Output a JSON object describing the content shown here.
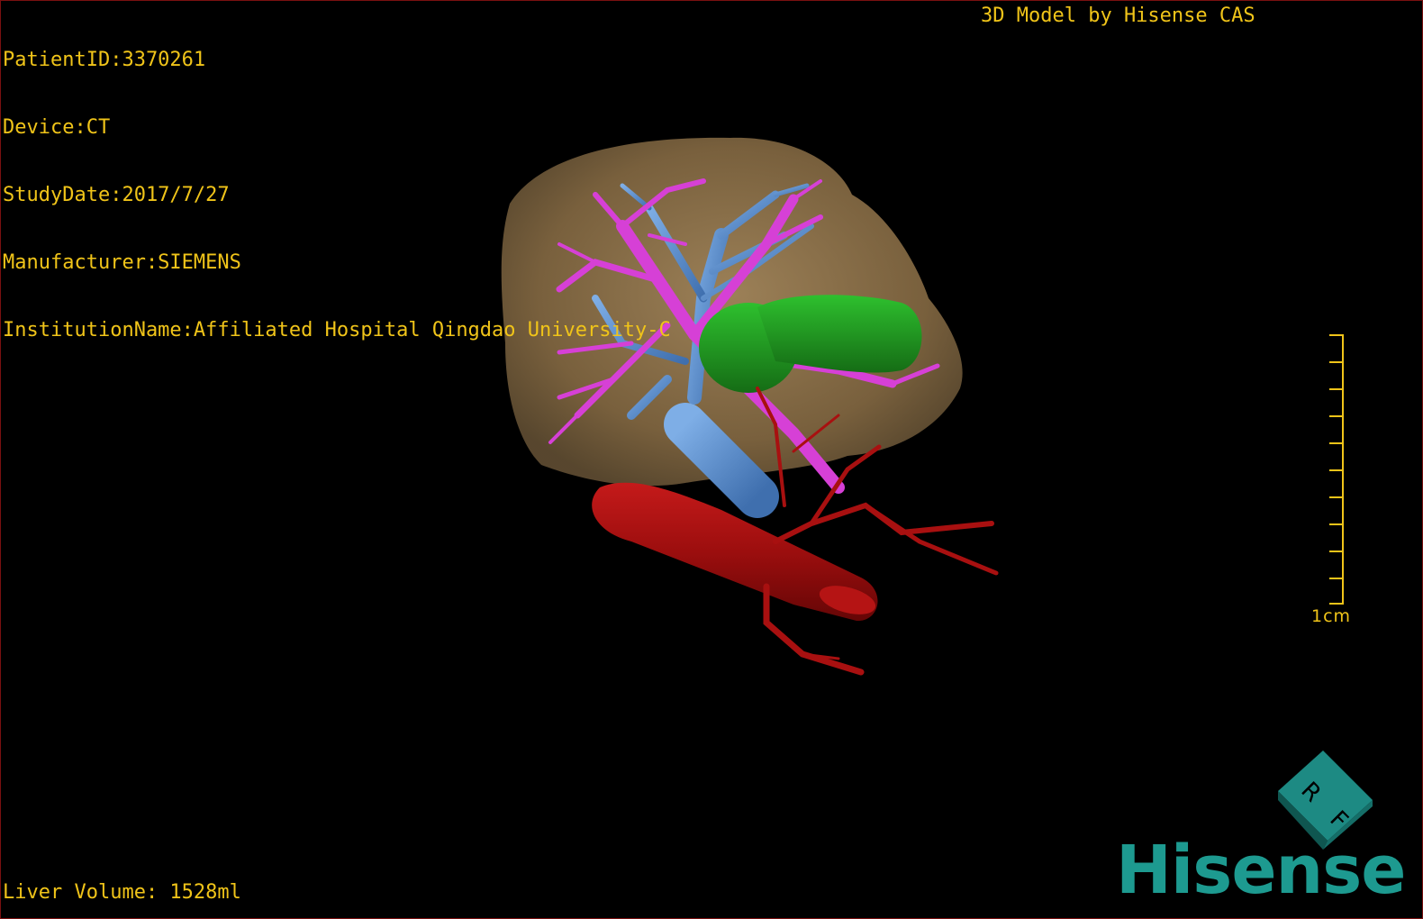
{
  "overlay": {
    "patient_id": "PatientID:3370261",
    "device": "Device:CT",
    "study_date": "StudyDate:2017/7/27",
    "manufacturer": "Manufacturer:SIEMENS",
    "institution": "InstitutionName:Affiliated Hospital Qingdao University-C",
    "credit": "3D Model by Hisense CAS",
    "liver_volume": "Liver Volume: 1528ml"
  },
  "scale_bar": {
    "label": "1cm"
  },
  "orientation_cube": {
    "labels": [
      "R",
      "F"
    ]
  },
  "logo": {
    "text": "Hisense"
  },
  "colors": {
    "overlay_text": "#f0c419",
    "liver": "#8a6e45",
    "hepatic_vein": "#d640d6",
    "portal_vein": "#5b8fd0",
    "artery_ivc": "#a81010",
    "tumor": "#1f9a1f",
    "logo": "#1d9a90",
    "cube": "#1d8a83"
  }
}
